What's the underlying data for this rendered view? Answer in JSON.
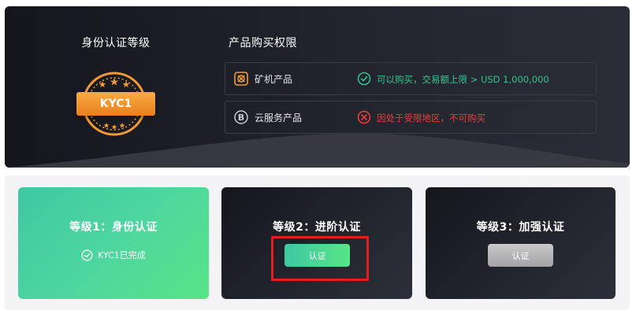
{
  "kyc": {
    "title": "身份认证等级",
    "badge_label": "KYC1",
    "badge_color": "#f39a35"
  },
  "permissions": {
    "title": "产品购买权限",
    "rows": [
      {
        "icon": "mining-icon",
        "name": "矿机产品",
        "status_icon": "check-circle-icon",
        "status": "可以购买，交易额上限 > USD 1,000,000",
        "status_color": "#36c48f"
      },
      {
        "icon": "bitcoin-icon",
        "name": "云服务产品",
        "status_icon": "x-circle-icon",
        "status": "因处于受限地区，不可购买",
        "status_color": "#ef3b3b"
      }
    ]
  },
  "levels": [
    {
      "title": "等级1：身份认证",
      "completed_text": "KYC1已完成",
      "state": "completed"
    },
    {
      "title": "等级2：进阶认证",
      "button_label": "认证",
      "state": "active"
    },
    {
      "title": "等级3：加强认证",
      "button_label": "认证",
      "state": "disabled"
    }
  ],
  "colors": {
    "accent_green": "#3ec8a2",
    "accent_orange": "#f39a35",
    "dark_card": "#1c1d24",
    "highlight_red": "#e0201f"
  }
}
